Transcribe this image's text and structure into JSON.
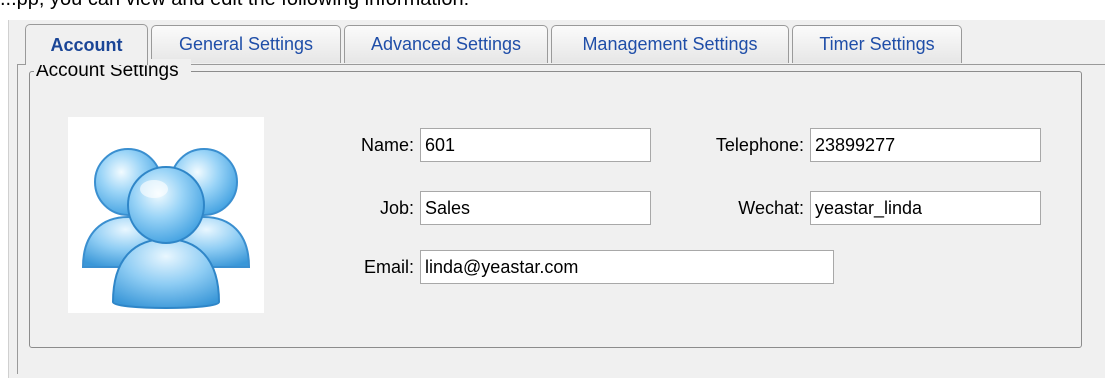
{
  "caption": "...pp, you can view and edit the following information:",
  "tabs": [
    {
      "label": "Account",
      "active": true
    },
    {
      "label": "General Settings",
      "active": false
    },
    {
      "label": "Advanced Settings",
      "active": false
    },
    {
      "label": "Management Settings",
      "active": false
    },
    {
      "label": "Timer Settings",
      "active": false
    }
  ],
  "group": {
    "title": "Account Settings"
  },
  "avatar": {
    "icon": "users-group-icon",
    "color": "#5bb4ee"
  },
  "form": {
    "name": {
      "label": "Name:",
      "value": "601"
    },
    "job": {
      "label": "Job:",
      "value": "Sales"
    },
    "email": {
      "label": "Email:",
      "value": "linda@yeastar.com"
    },
    "telephone": {
      "label": "Telephone:",
      "value": "23899277"
    },
    "wechat": {
      "label": "Wechat:",
      "value": "yeastar_linda"
    }
  }
}
